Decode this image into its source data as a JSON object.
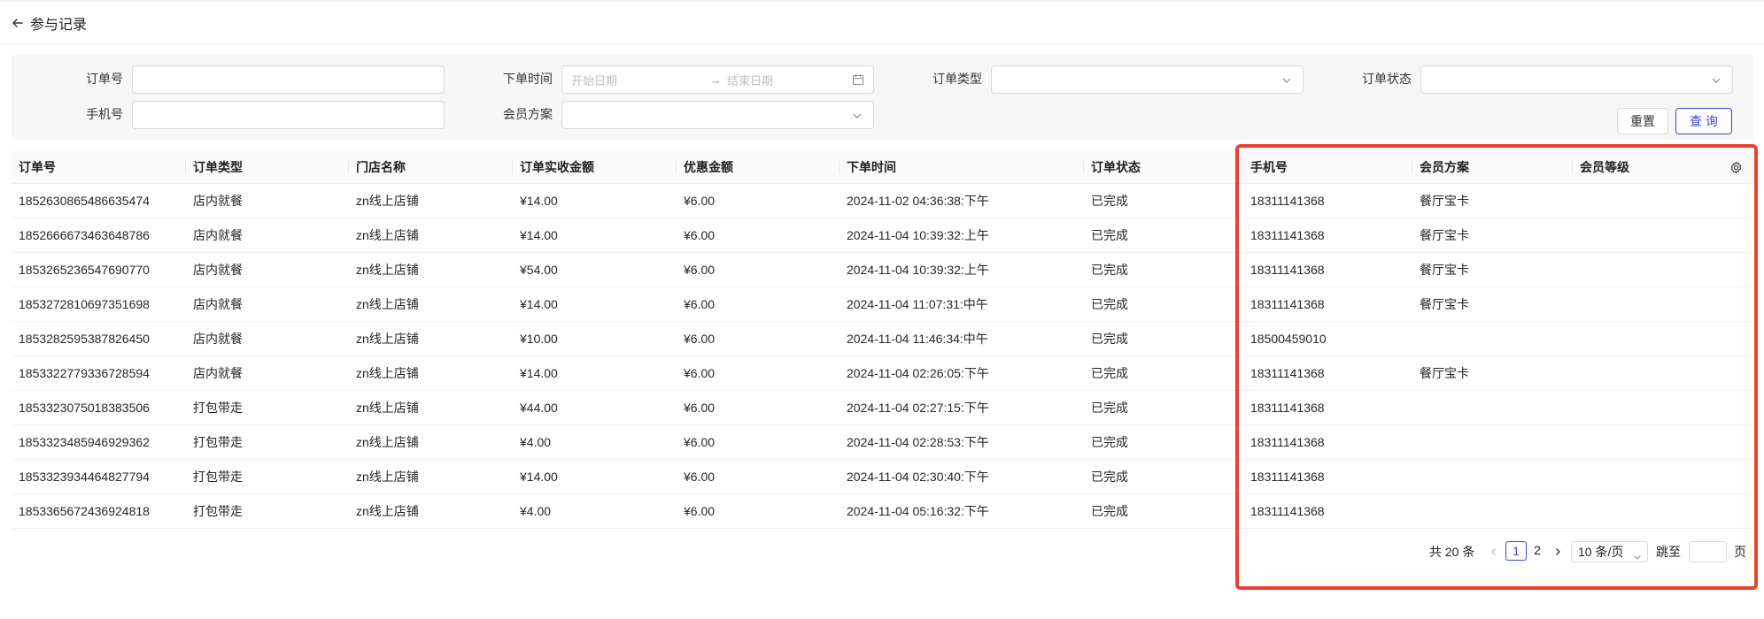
{
  "header": {
    "title": "参与记录"
  },
  "filters": {
    "order_no_label": "订单号",
    "order_time_label": "下单时间",
    "start_placeholder": "开始日期",
    "range_separator": "→",
    "end_placeholder": "结束日期",
    "order_type_label": "订单类型",
    "order_status_label": "订单状态",
    "phone_label": "手机号",
    "member_plan_label": "会员方案",
    "reset_label": "重置",
    "query_label": "查 询"
  },
  "table": {
    "columns": [
      "订单号",
      "订单类型",
      "门店名称",
      "订单实收金额",
      "优惠金额",
      "下单时间",
      "订单状态",
      "手机号",
      "会员方案",
      "会员等级"
    ],
    "rows": [
      [
        "1852630865486635474",
        "店内就餐",
        "zn线上店铺",
        "¥14.00",
        "¥6.00",
        "2024-11-02 04:36:38:下午",
        "已完成",
        "18311141368",
        "餐厅宝卡",
        ""
      ],
      [
        "1852666673463648786",
        "店内就餐",
        "zn线上店铺",
        "¥14.00",
        "¥6.00",
        "2024-11-04 10:39:32:上午",
        "已完成",
        "18311141368",
        "餐厅宝卡",
        ""
      ],
      [
        "1853265236547690770",
        "店内就餐",
        "zn线上店铺",
        "¥54.00",
        "¥6.00",
        "2024-11-04 10:39:32:上午",
        "已完成",
        "18311141368",
        "餐厅宝卡",
        ""
      ],
      [
        "1853272810697351698",
        "店内就餐",
        "zn线上店铺",
        "¥14.00",
        "¥6.00",
        "2024-11-04 11:07:31:中午",
        "已完成",
        "18311141368",
        "餐厅宝卡",
        ""
      ],
      [
        "1853282595387826450",
        "店内就餐",
        "zn线上店铺",
        "¥10.00",
        "¥6.00",
        "2024-11-04 11:46:34:中午",
        "已完成",
        "18500459010",
        "",
        ""
      ],
      [
        "1853322779336728594",
        "店内就餐",
        "zn线上店铺",
        "¥14.00",
        "¥6.00",
        "2024-11-04 02:26:05:下午",
        "已完成",
        "18311141368",
        "餐厅宝卡",
        ""
      ],
      [
        "1853323075018383506",
        "打包带走",
        "zn线上店铺",
        "¥44.00",
        "¥6.00",
        "2024-11-04 02:27:15:下午",
        "已完成",
        "18311141368",
        "",
        ""
      ],
      [
        "1853323485946929362",
        "打包带走",
        "zn线上店铺",
        "¥4.00",
        "¥6.00",
        "2024-11-04 02:28:53:下午",
        "已完成",
        "18311141368",
        "",
        ""
      ],
      [
        "1853323934464827794",
        "打包带走",
        "zn线上店铺",
        "¥14.00",
        "¥6.00",
        "2024-11-04 02:30:40:下午",
        "已完成",
        "18311141368",
        "",
        ""
      ],
      [
        "1853365672436924818",
        "打包带走",
        "zn线上店铺",
        "¥4.00",
        "¥6.00",
        "2024-11-04 05:16:32:下午",
        "已完成",
        "18311141368",
        "",
        ""
      ]
    ]
  },
  "pagination": {
    "total_text": "共 20 条",
    "pages": [
      "1",
      "2"
    ],
    "current_page": "1",
    "page_size": "10 条/页",
    "jump_label": "跳至",
    "page_suffix": "页"
  },
  "colors": {
    "accent": "#3b45d9",
    "highlight": "#e8422f"
  },
  "icons": [
    "back-arrow-icon",
    "calendar-icon",
    "chevron-down-icon",
    "settings-icon",
    "chevron-left-icon",
    "chevron-right-icon"
  ]
}
